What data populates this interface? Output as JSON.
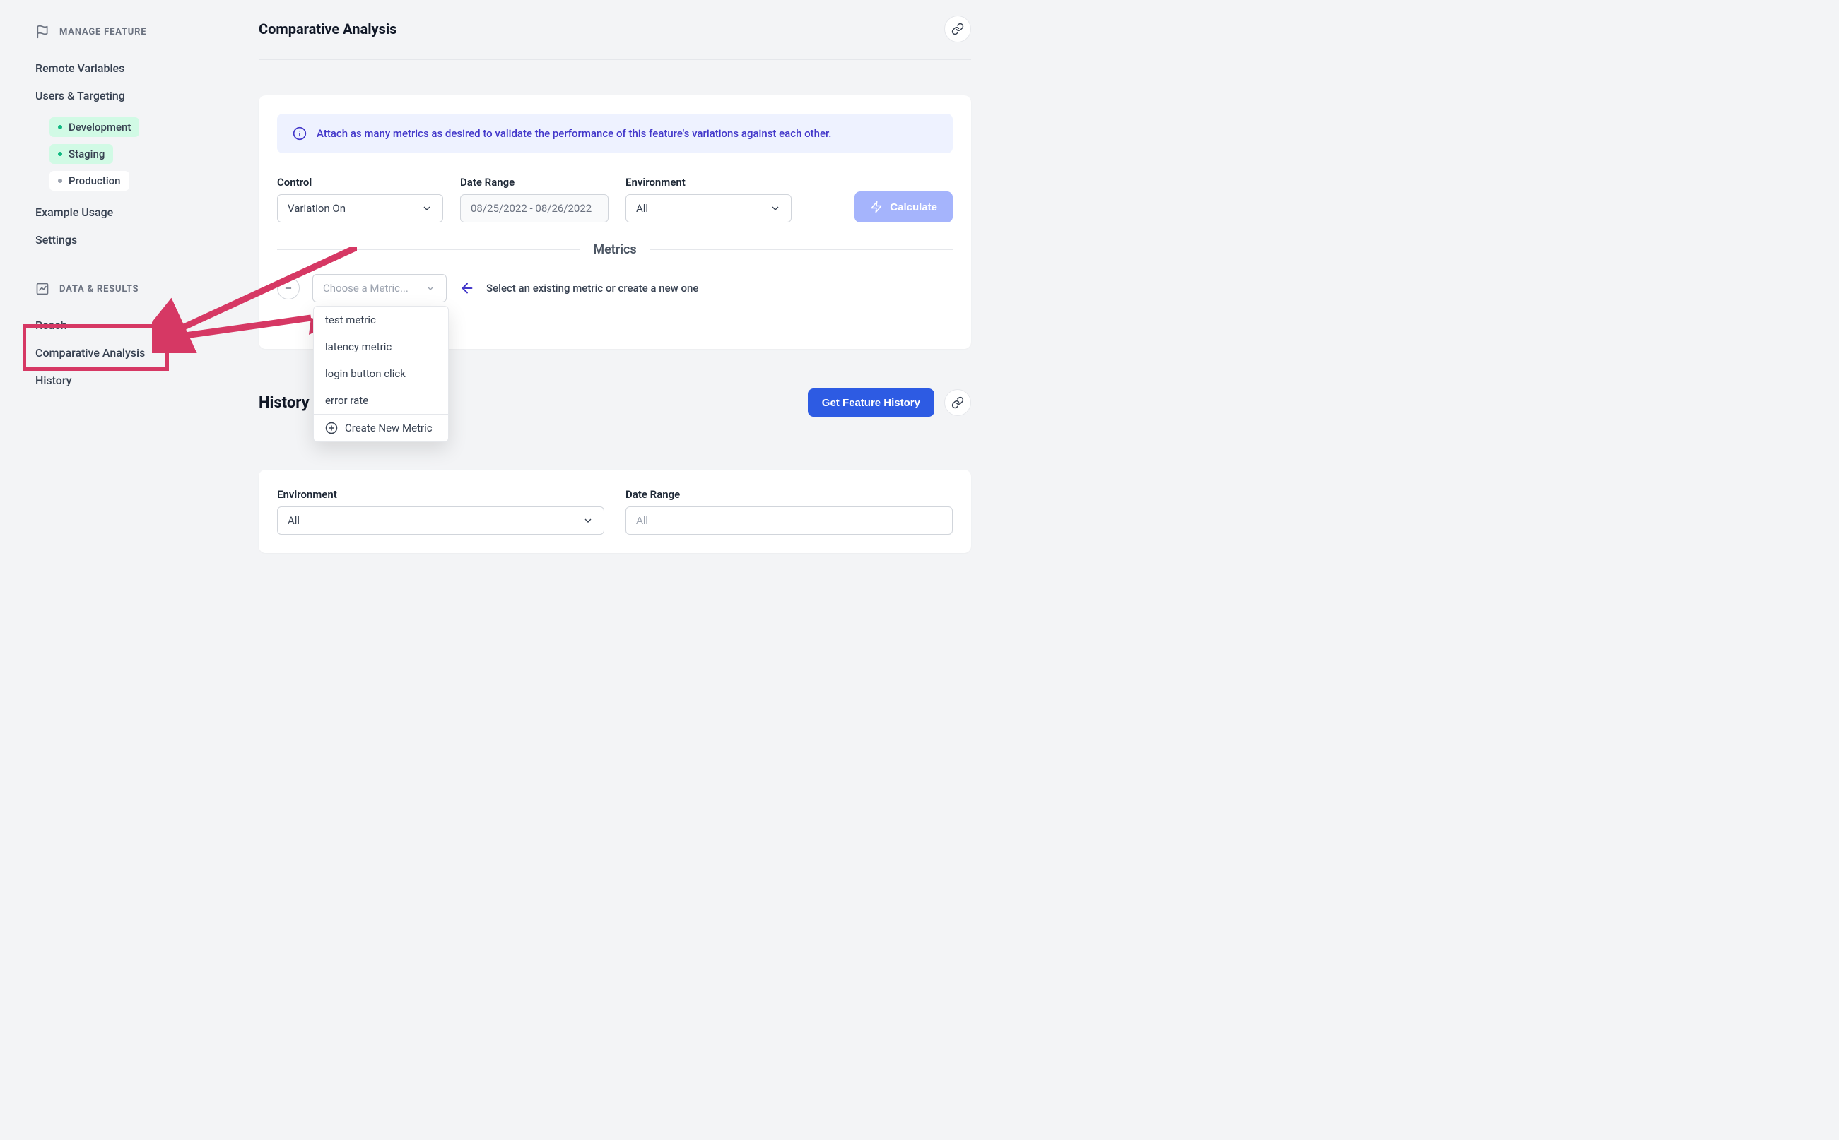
{
  "sidebar": {
    "manage_feature_label": "MANAGE FEATURE",
    "remote_variables": "Remote Variables",
    "users_targeting": "Users & Targeting",
    "env_development": "Development",
    "env_staging": "Staging",
    "env_production": "Production",
    "example_usage": "Example Usage",
    "settings": "Settings",
    "data_results_label": "DATA & RESULTS",
    "reach": "Reach",
    "comparative_analysis": "Comparative Analysis",
    "history": "History"
  },
  "page": {
    "title": "Comparative Analysis"
  },
  "banner": {
    "text": "Attach as many metrics as desired to validate the performance of this feature's variations against each other."
  },
  "controls": {
    "control_label": "Control",
    "control_value": "Variation On",
    "date_range_label": "Date Range",
    "date_range_value": "08/25/2022 - 08/26/2022",
    "environment_label": "Environment",
    "environment_value": "All",
    "calculate_label": "Calculate"
  },
  "metrics": {
    "divider_label": "Metrics",
    "choose_placeholder": "Choose a Metric...",
    "helper_text": "Select an existing metric or create a new one",
    "options": {
      "test_metric": "test metric",
      "latency_metric": "latency metric",
      "login_button_click": "login button click",
      "error_rate": "error rate"
    },
    "create_new": "Create New Metric"
  },
  "history": {
    "title": "History",
    "get_history_label": "Get Feature History",
    "environment_label": "Environment",
    "environment_value": "All",
    "date_range_label": "Date Range",
    "date_range_placeholder": "All"
  },
  "colors": {
    "annotation": "#d63864"
  }
}
